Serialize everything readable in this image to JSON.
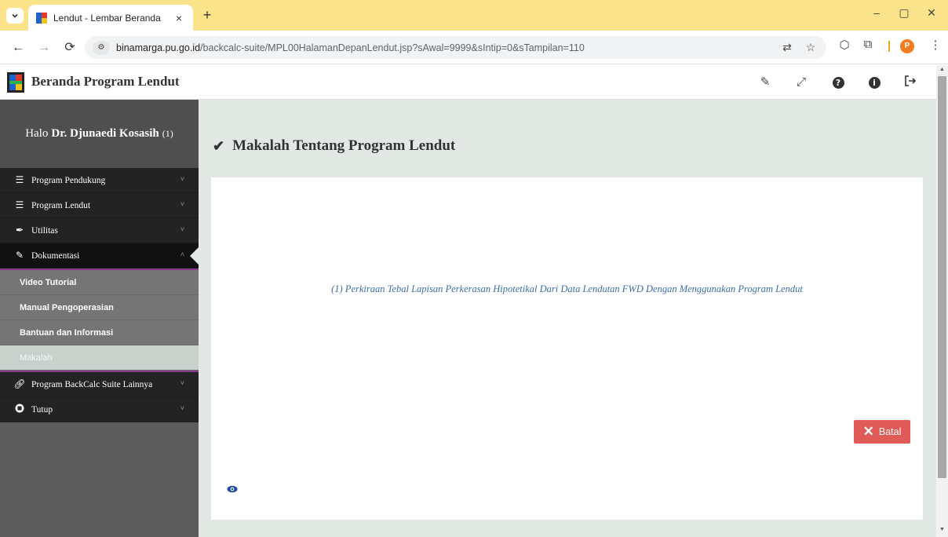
{
  "browser": {
    "tab_title": "Lendut - Lembar Beranda",
    "tab_close": "×",
    "new_tab": "+",
    "url_domain": "binamarga.pu.go.id",
    "url_path": "/backcalc-suite/MPL00HalamanDepanLendut.jsp?sAwal=9999&sIntip=0&sTampilan=110",
    "profile_initial": "P",
    "minimize": "–",
    "restore": "▢",
    "close": "✕"
  },
  "header": {
    "title": "Beranda Program Lendut"
  },
  "sidebar": {
    "greeting_prefix": "Halo",
    "user_name": "Dr. Djunaedi Kosasih",
    "user_suffix": "(1)",
    "menu": [
      {
        "label": "Program Pendukung",
        "icon": "list-icon",
        "chevron": "˅"
      },
      {
        "label": "Program Lendut",
        "icon": "list-icon",
        "chevron": "˅"
      },
      {
        "label": "Utilitas",
        "icon": "feather-icon",
        "chevron": "˅"
      },
      {
        "label": "Dokumentasi",
        "icon": "pencil-icon",
        "chevron": "˄"
      }
    ],
    "submenu": [
      {
        "label": "Video Tutorial"
      },
      {
        "label": "Manual Pengoperasian"
      },
      {
        "label": "Bantuan dan Informasi"
      },
      {
        "label": "Makalah"
      }
    ],
    "menu_after": [
      {
        "label": "Program BackCalc Suite Lainnya",
        "icon": "link-icon",
        "chevron": "˅"
      },
      {
        "label": "Tutup",
        "icon": "stop-icon",
        "chevron": "˅"
      }
    ]
  },
  "main": {
    "title": "Makalah Tentang Program Lendut",
    "paper_link": "(1) Perkiraan Tebal Lapisan Perkerasan Hipotetikal Dari Data Lendutan FWD Dengan Menggunakan Program Lendut",
    "cancel_label": "Batal"
  },
  "colors": {
    "accent_red": "#e05a57",
    "sidebar_bg": "#5c5c5c",
    "menu_bg": "#232323",
    "content_bg": "#e2e8e4",
    "link_blue": "#3b6ea5",
    "tabbar_yellow": "#fbe38a"
  }
}
